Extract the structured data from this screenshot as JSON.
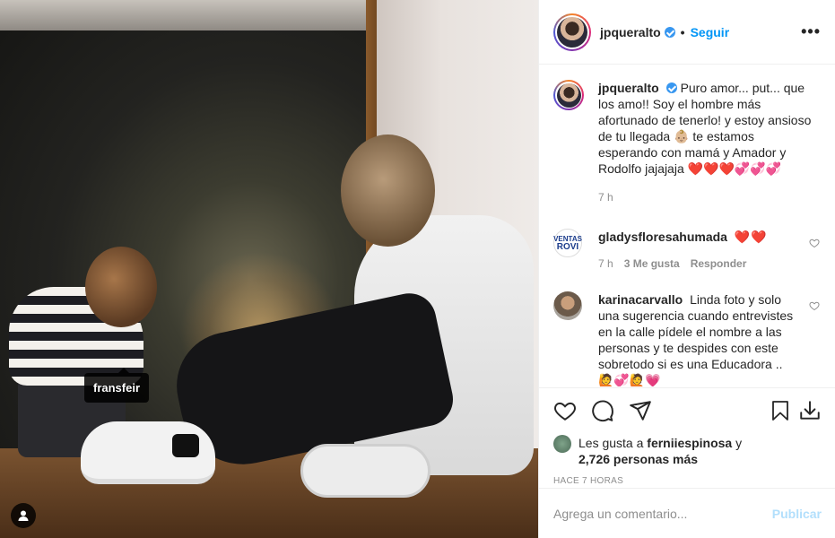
{
  "photo": {
    "tag_label": "fransfeir",
    "user_tag_icon": "person-icon"
  },
  "header": {
    "username": "jpqueralto",
    "separator": "•",
    "follow_label": "Seguir",
    "more_label": "•••"
  },
  "caption": {
    "username": "jpqueralto",
    "text": "Puro amor... put... que los amo!! Soy el hombre más afortunado de tenerlo! y estoy ansioso de tu llegada 👶🏼 te estamos esperando con mamá y Amador y Rodolfo jajajaja ❤️❤️❤️💞💞💞",
    "time": "7 h"
  },
  "comments": [
    {
      "username": "gladysfloresahumada",
      "text": "❤️❤️",
      "time": "7 h",
      "likes": "3 Me gusta",
      "reply_label": "Responder",
      "avatar_text_top": "VENTAS",
      "avatar_text_main": "ROVI"
    },
    {
      "username": "karinacarvallo",
      "text": "Linda foto y solo una sugerencia cuando entrevistes en la calle pídele el nombre a las personas y te despides con este sobretodo si es una Educadora .. 🙋💞🙋💗"
    }
  ],
  "likes": {
    "prefix": "Les gusta a",
    "first_user": "ferniiespinosa",
    "conj": "y",
    "others": "2,726 personas más"
  },
  "time_ago": "HACE 7 HORAS",
  "add_comment": {
    "placeholder": "Agrega un comentario...",
    "post_label": "Publicar"
  },
  "colors": {
    "accent": "#0095f6",
    "verified": "#3897f0",
    "post_disabled": "#b2dffc",
    "heart": "#ed1c24"
  }
}
